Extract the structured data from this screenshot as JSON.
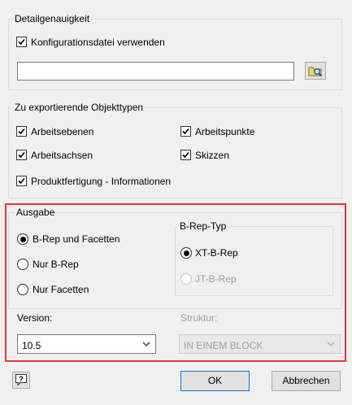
{
  "detail": {
    "title": "Detailgenauigkeit",
    "use_config_label": "Konfigurationsdatei verwenden",
    "use_config_checked": true,
    "config_path": ""
  },
  "objects": {
    "title": "Zu exportierende Objekttypen",
    "items": [
      {
        "label": "Arbeitsebenen",
        "checked": true
      },
      {
        "label": "Arbeitspunkte",
        "checked": true
      },
      {
        "label": "Arbeitsachsen",
        "checked": true
      },
      {
        "label": "Skizzen",
        "checked": true
      },
      {
        "label": "Produktfertigung - Informationen",
        "checked": true
      }
    ]
  },
  "output": {
    "title": "Ausgabe",
    "options": [
      {
        "label": "B-Rep und Facetten",
        "selected": true
      },
      {
        "label": "Nur B-Rep",
        "selected": false
      },
      {
        "label": "Nur Facetten",
        "selected": false
      }
    ],
    "brep_type": {
      "title": "B-Rep-Typ",
      "options": [
        {
          "label": "XT-B-Rep",
          "selected": true,
          "enabled": true
        },
        {
          "label": "JT-B-Rep",
          "selected": false,
          "enabled": false
        }
      ]
    },
    "version_label": "Version:",
    "version_value": "10.5",
    "structure_label": "Struktur:",
    "structure_value": "IN EINEM BLOCK"
  },
  "buttons": {
    "help_icon": "help-icon",
    "ok": "OK",
    "cancel": "Abbrechen"
  },
  "colors": {
    "highlight": "#e8323c",
    "background": "#f0f0f0"
  }
}
